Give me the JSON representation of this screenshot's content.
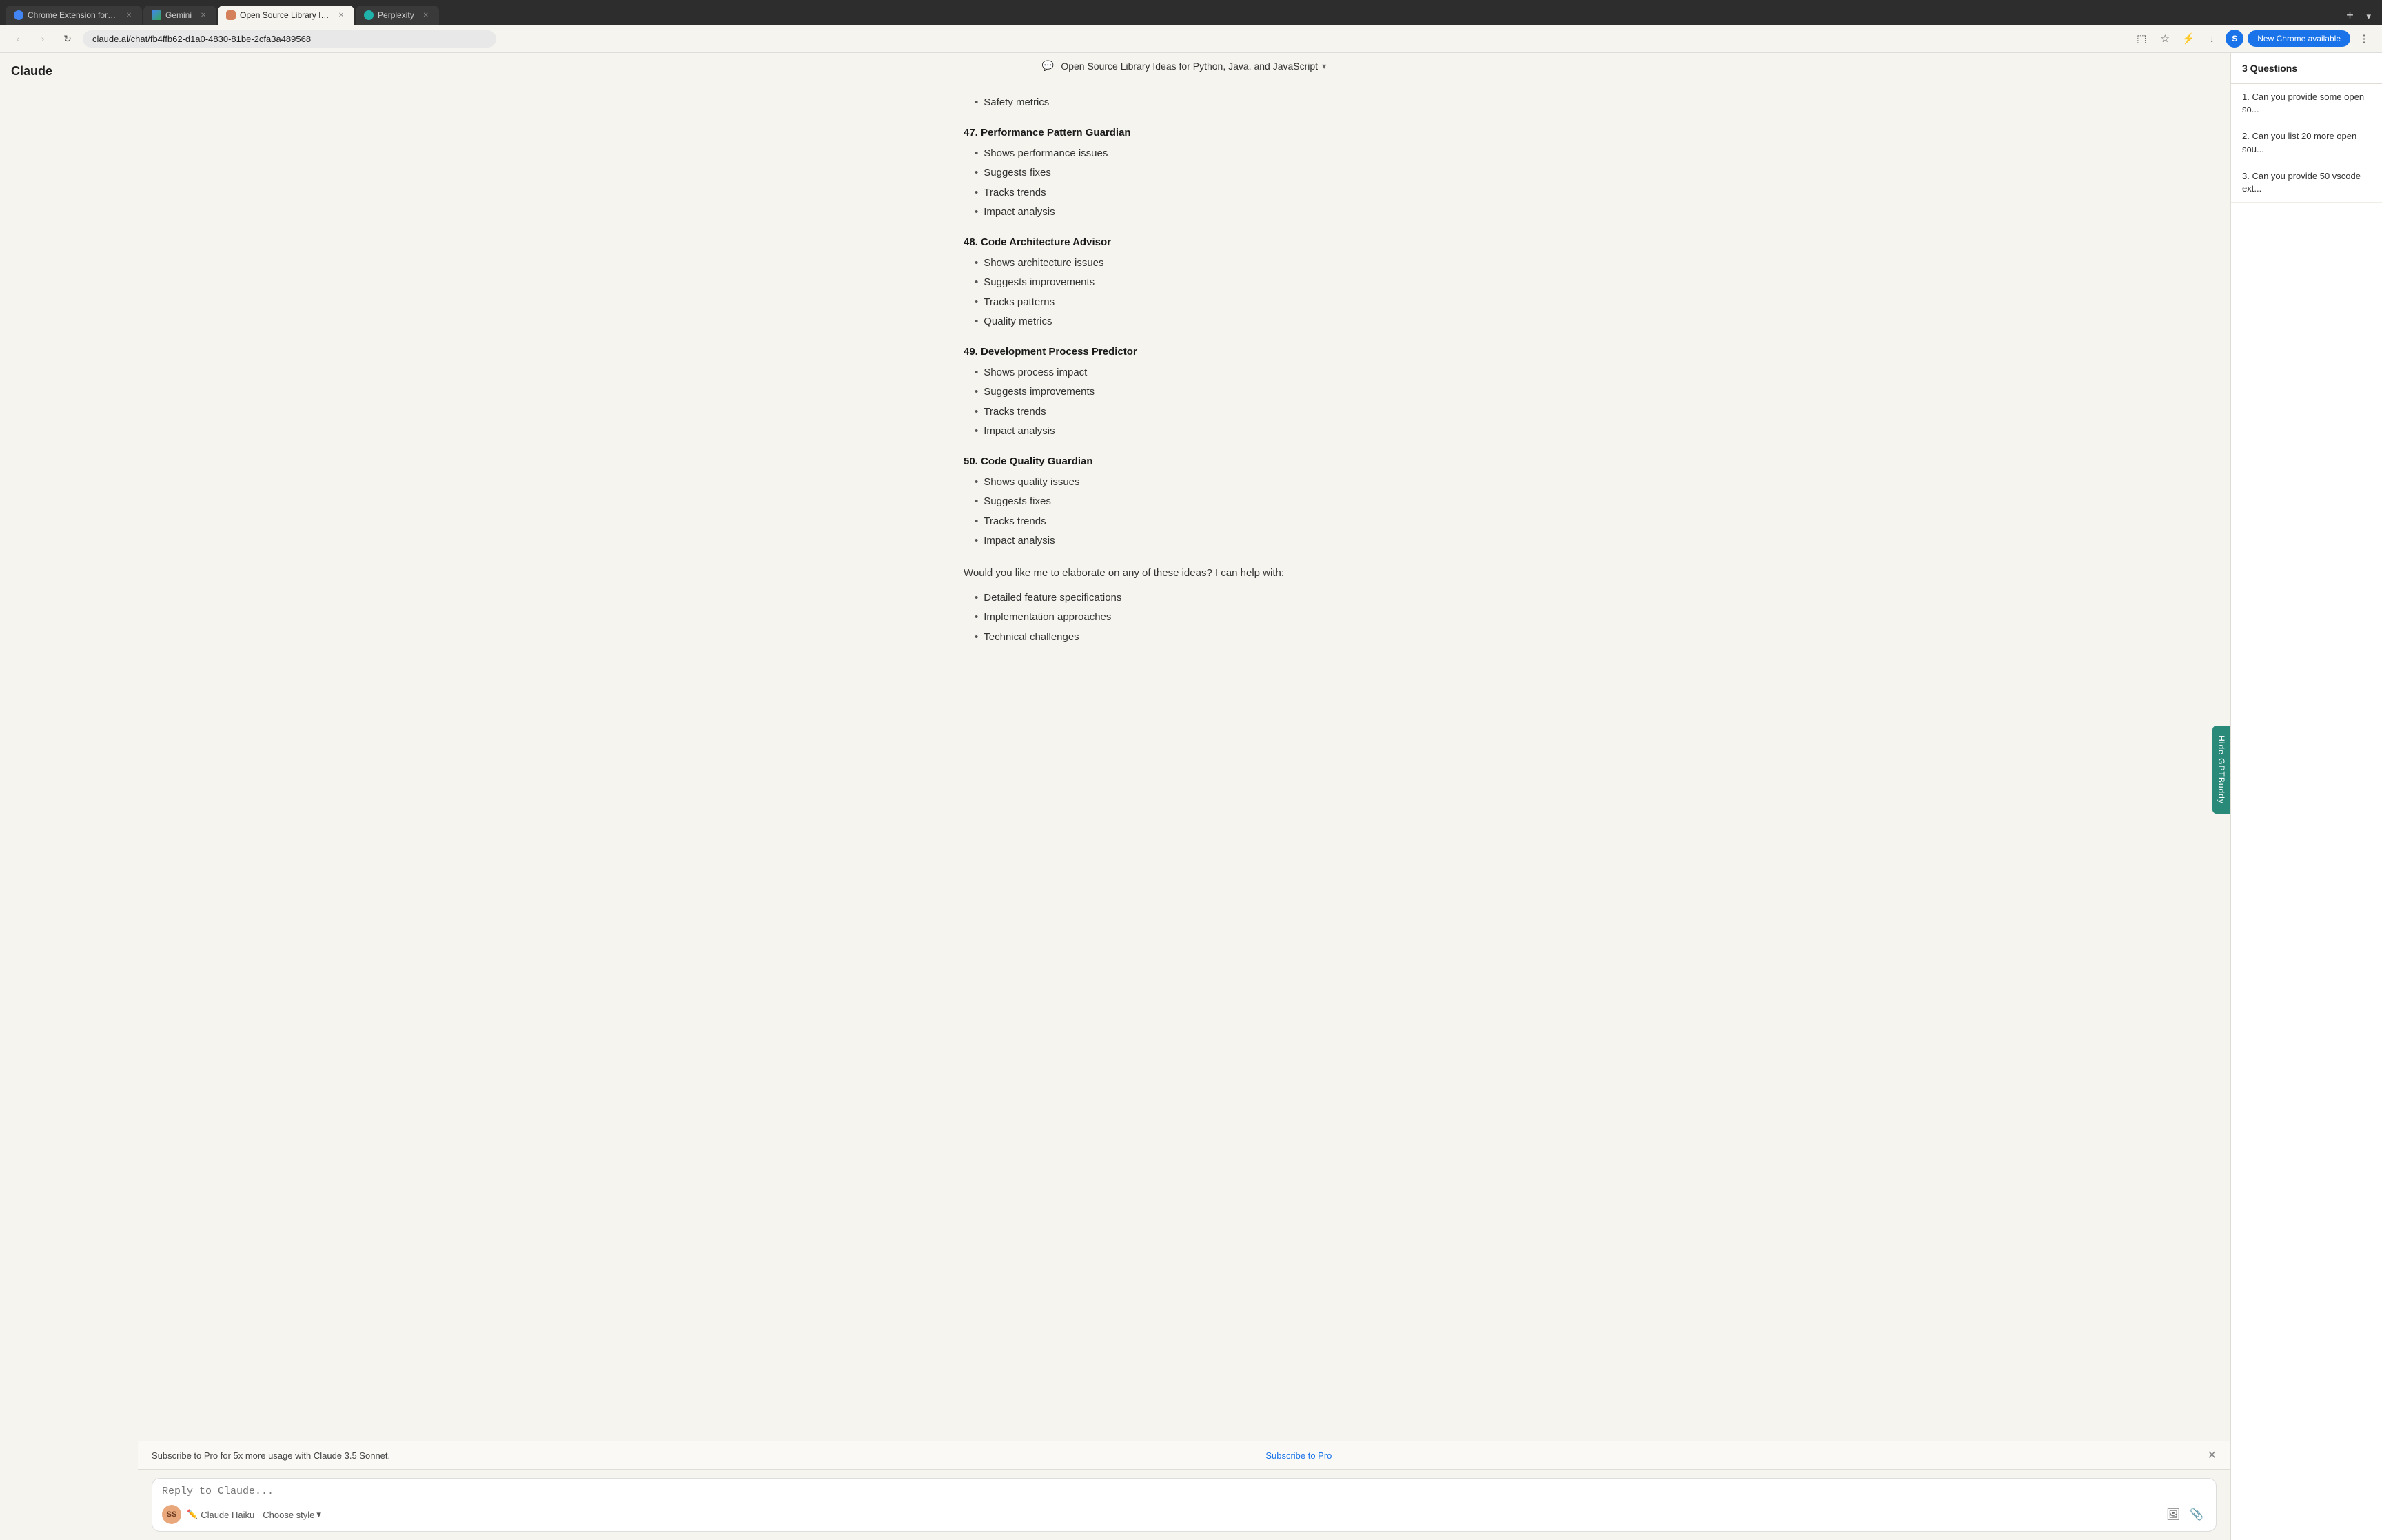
{
  "browser": {
    "tabs": [
      {
        "id": "tab-chrome-ext",
        "favicon_type": "favicon-chrome",
        "label": "Chrome Extension for AI Cha...",
        "active": false,
        "closeable": true
      },
      {
        "id": "tab-gemini",
        "favicon_type": "favicon-gemini",
        "label": "Gemini",
        "active": false,
        "closeable": true
      },
      {
        "id": "tab-claude",
        "favicon_type": "favicon-claude",
        "label": "Open Source Library Ideas fo...",
        "active": true,
        "closeable": true
      },
      {
        "id": "tab-perplexity",
        "favicon_type": "favicon-perplexity",
        "label": "Perplexity",
        "active": false,
        "closeable": true
      }
    ],
    "address": "claude.ai/chat/fb4ffb62-d1a0-4830-81be-2cfa3a489568",
    "new_chrome_label": "New Chrome available"
  },
  "chat": {
    "title": "Open Source Library Ideas for Python, Java, and JavaScript",
    "items": [
      {
        "number": "47",
        "name": "Performance Pattern Guardian",
        "bullets": [
          "Shows performance issues",
          "Suggests fixes",
          "Tracks trends",
          "Impact analysis"
        ]
      },
      {
        "number": "48",
        "name": "Code Architecture Advisor",
        "bullets": [
          "Shows architecture issues",
          "Suggests improvements",
          "Tracks patterns",
          "Quality metrics"
        ]
      },
      {
        "number": "49",
        "name": "Development Process Predictor",
        "bullets": [
          "Shows process impact",
          "Suggests improvements",
          "Tracks trends",
          "Impact analysis"
        ]
      },
      {
        "number": "50",
        "name": "Code Quality Guardian",
        "bullets": [
          "Shows quality issues",
          "Suggests fixes",
          "Tracks trends",
          "Impact analysis"
        ]
      }
    ],
    "top_bullet": "Safety metrics",
    "elaboration": "Would you like me to elaborate on any of these ideas? I can help with:",
    "elaboration_bullets": [
      "Detailed feature specifications",
      "Implementation approaches",
      "Technical challenges"
    ]
  },
  "subscribe_banner": {
    "text": "Subscribe to Pro for 5x more usage with Claude 3.5 Sonnet.",
    "link_label": "Subscribe to Pro"
  },
  "input": {
    "placeholder": "Reply to Claude...",
    "model_label": "Claude Haiku",
    "style_label": "Choose style"
  },
  "right_sidebar": {
    "header": "3 Questions",
    "questions": [
      {
        "number": "1",
        "text": "Can you provide some open so..."
      },
      {
        "number": "2",
        "text": "Can you list 20 more open sou..."
      },
      {
        "number": "3",
        "text": "Can you provide 50 vscode ext..."
      }
    ]
  },
  "gptbuddy": {
    "label": "Hide GPTBuddy"
  },
  "profile": {
    "initial": "S"
  },
  "user_avatar": {
    "initials": "SS"
  }
}
